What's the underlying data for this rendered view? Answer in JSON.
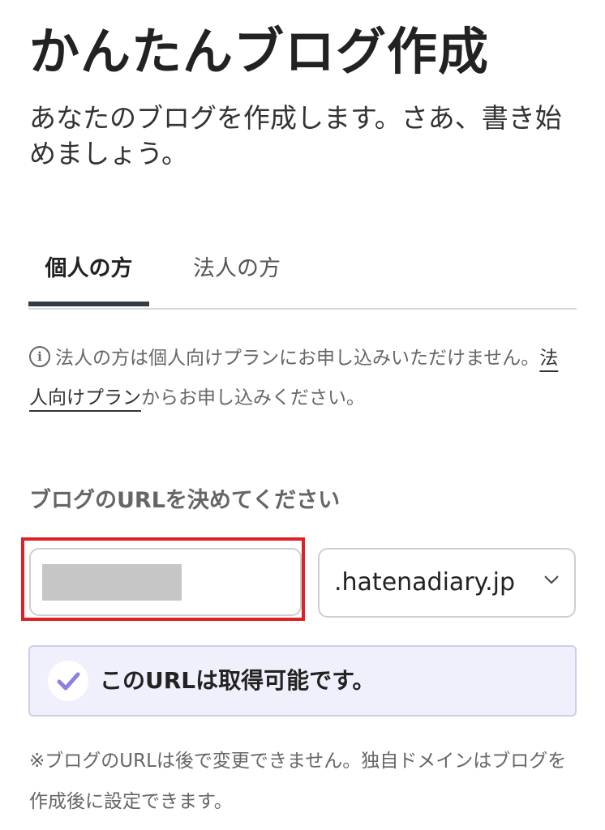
{
  "header": {
    "title": "かんたんブログ作成",
    "lead": "あなたのブログを作成します。さあ、書き始めましょう。"
  },
  "tabs": [
    {
      "label": "個人の方",
      "active": true
    },
    {
      "label": "法人の方",
      "active": false
    }
  ],
  "notice": {
    "icon": "info-icon",
    "icon_glyph": "i",
    "text_before": "法人の方は個人向けプランにお申し込みいただけません。",
    "link_label": "法人向けプラン",
    "text_after": "からお申し込みください。"
  },
  "url_form": {
    "label": "ブログのURLを決めてください",
    "subdomain_value": "",
    "domain_selected": ".hatenadiary.jp",
    "highlight_color": "#e01f26"
  },
  "status": {
    "icon": "check-icon",
    "message": "このURLは取得可能です。",
    "background": "#eff0fb",
    "check_color": "#8b82e0"
  },
  "footnote": "※ブログのURLは後で変更できません。独自ドメインはブログを作成後に設定できます。"
}
